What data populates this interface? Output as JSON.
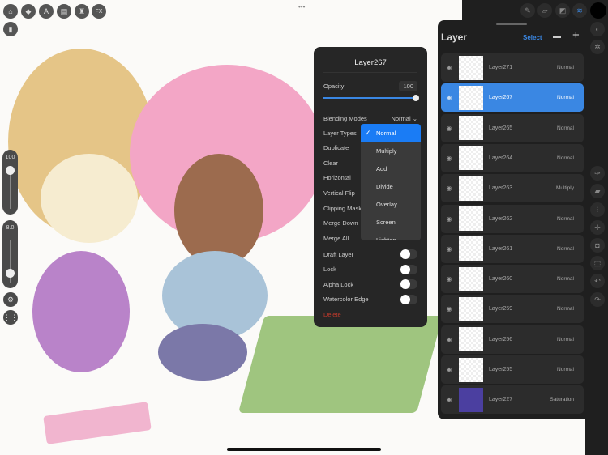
{
  "canvas_tools": [
    {
      "icon": "home-icon",
      "glyph": "⌂"
    },
    {
      "icon": "shapes-icon",
      "glyph": "◆"
    },
    {
      "icon": "text-icon",
      "glyph": "A"
    },
    {
      "icon": "reference-icon",
      "glyph": "▤"
    },
    {
      "icon": "gift-icon",
      "glyph": "♜"
    },
    {
      "icon": "fx-icon",
      "glyph": "FX"
    }
  ],
  "brush_size": "100",
  "brush_opacity": "8.0",
  "layer_menu": {
    "title": "Layer267",
    "opacity_label": "Opacity",
    "opacity_value": "100",
    "opacity_fraction": 1.0,
    "blending_label": "Blending Modes",
    "blending_value": "Normal",
    "items": [
      "Layer Types",
      "Duplicate",
      "Clear",
      "Horizontal",
      "Vertical Flip",
      "Clipping Mask",
      "Merge Down",
      "Merge All"
    ],
    "toggles": [
      "Draft Layer",
      "Lock",
      "Alpha Lock",
      "Watercolor Edge"
    ],
    "delete_label": "Delete"
  },
  "blend_dropdown": {
    "options": [
      "Normal",
      "Multiply",
      "Add",
      "Divide",
      "Overlay",
      "Screen",
      "Lighten"
    ],
    "selected": "Normal"
  },
  "layer_panel": {
    "title": "Layer",
    "select_label": "Select",
    "layers": [
      {
        "name": "Layer271",
        "mode": "Normal"
      },
      {
        "name": "Layer267",
        "mode": "Normal",
        "selected": true
      },
      {
        "name": "Layer265",
        "mode": "Normal"
      },
      {
        "name": "Layer264",
        "mode": "Normal"
      },
      {
        "name": "Layer263",
        "mode": "Multiply"
      },
      {
        "name": "Layer262",
        "mode": "Normal"
      },
      {
        "name": "Layer261",
        "mode": "Normal"
      },
      {
        "name": "Layer260",
        "mode": "Normal"
      },
      {
        "name": "Layer259",
        "mode": "Normal"
      },
      {
        "name": "Layer256",
        "mode": "Normal"
      },
      {
        "name": "Layer255",
        "mode": "Normal"
      },
      {
        "name": "Layer227",
        "mode": "Saturation"
      }
    ]
  },
  "colors": {
    "accent": "#3a87e3",
    "selected_option": "#1a7cf5",
    "delete": "#c0392b",
    "current_color": "#000000"
  }
}
